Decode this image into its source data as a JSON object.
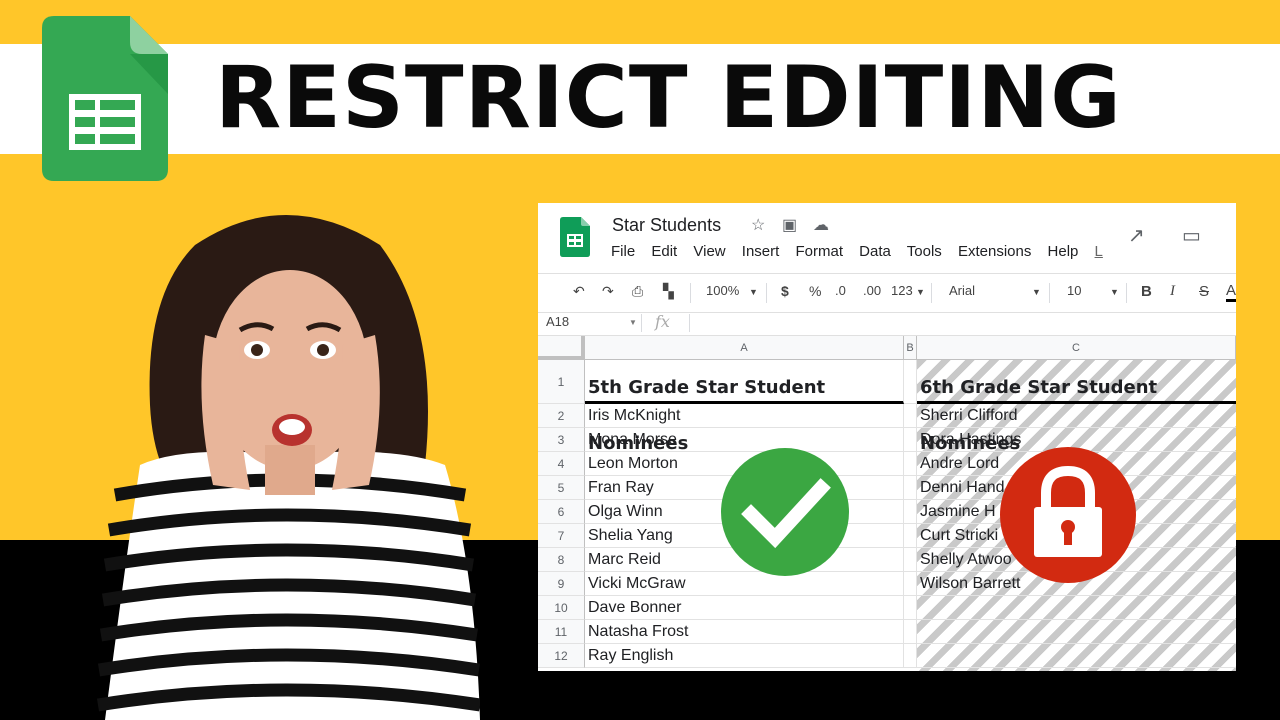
{
  "banner": {
    "title": "RESTRICT EDITING"
  },
  "colors": {
    "yellow": "#FFC629",
    "green": "#3BA742",
    "red": "#D22A11",
    "black": "#000000"
  },
  "icons": {
    "logo": "google-sheets-logo-icon",
    "check": "check-circle-icon",
    "lock": "lock-icon"
  },
  "sheet": {
    "doc_title": "Star Students",
    "menu": [
      "File",
      "Edit",
      "View",
      "Insert",
      "Format",
      "Data",
      "Tools",
      "Extensions",
      "Help",
      "L"
    ],
    "toolbar": {
      "zoom": "100%",
      "currency": "$",
      "percent": "%",
      "dec_decrease": ".0",
      "dec_increase": ".00",
      "more_formats": "123",
      "font": "Arial",
      "font_size": "10",
      "bold": "B",
      "italic": "I",
      "strike": "S",
      "text_color": "A"
    },
    "name_box": "A18",
    "fx": "fx",
    "columns": [
      "A",
      "B",
      "C"
    ],
    "rows": [
      "1",
      "2",
      "3",
      "4",
      "5",
      "6",
      "7",
      "8",
      "9",
      "10",
      "11",
      "12"
    ],
    "col_a_header": "5th Grade Star Student Nominees",
    "col_c_header": "6th Grade Star Student Nominees",
    "col_a": [
      "Iris McKnight",
      "Mona Morse",
      "Leon Morton",
      "Fran Ray",
      "Olga Winn",
      "Shelia Yang",
      "Marc Reid",
      "Vicki McGraw",
      "Dave Bonner",
      "Natasha Frost",
      "Ray English"
    ],
    "col_c": [
      "Sherri Clifford",
      "Dora Hastings",
      "Andre Lord",
      "Denni Hand",
      "Jasmine H",
      "Curt Stricki",
      "Shelly Atwoo",
      "Wilson Barrett",
      "",
      "",
      ""
    ]
  }
}
